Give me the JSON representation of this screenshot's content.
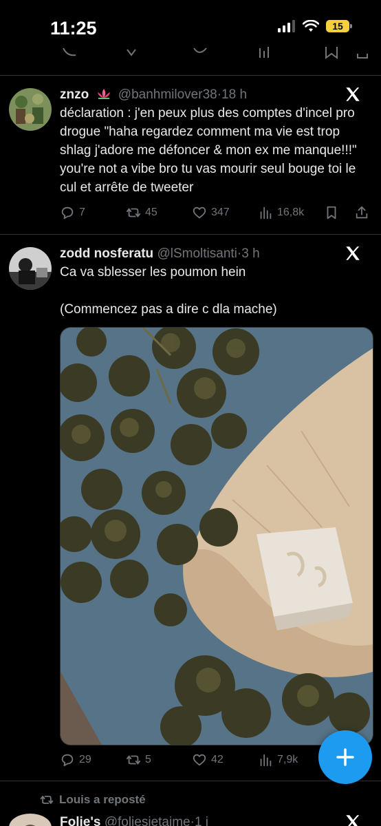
{
  "status_bar": {
    "time": "11:25",
    "battery": "15"
  },
  "tweets": [
    {
      "name": "znzo",
      "handle": "@banhmilover38",
      "dot": "·",
      "time": "18 h",
      "text": "déclaration : j'en peux plus des comptes d'incel pro drogue \"haha regardez comment ma vie est trop shlag j'adore me défoncer & mon ex me manque!!!\" you're not a vibe bro tu vas mourir seul bouge toi le cul et arrête de tweeter",
      "replies": "7",
      "reposts": "45",
      "likes": "347",
      "views": "16,8k"
    },
    {
      "name": "zodd nosferatu",
      "handle": "@lSmoltisanti",
      "dot": "·",
      "time": "3 h",
      "text": "Ca va sblesser les poumon hein\n\n(Commencez pas a dire c dla mache)",
      "replies": "29",
      "reposts": "5",
      "likes": "42",
      "views": "7,9k"
    }
  ],
  "repost_context": "Louis a reposté",
  "next_tweet": {
    "name": "Folie's",
    "handle": "@foliesjetaime",
    "dot": "·",
    "time": "1 j"
  },
  "colors": {
    "background": "#000000",
    "text": "#e7e9ea",
    "muted": "#71767b",
    "accent": "#1d9bf0",
    "divider": "#2f3336"
  },
  "icons": [
    "reply-icon",
    "repost-icon",
    "like-icon",
    "views-icon",
    "bookmark-icon",
    "share-icon",
    "x-logo-icon",
    "compose-icon",
    "signal-icon",
    "wifi-icon"
  ]
}
